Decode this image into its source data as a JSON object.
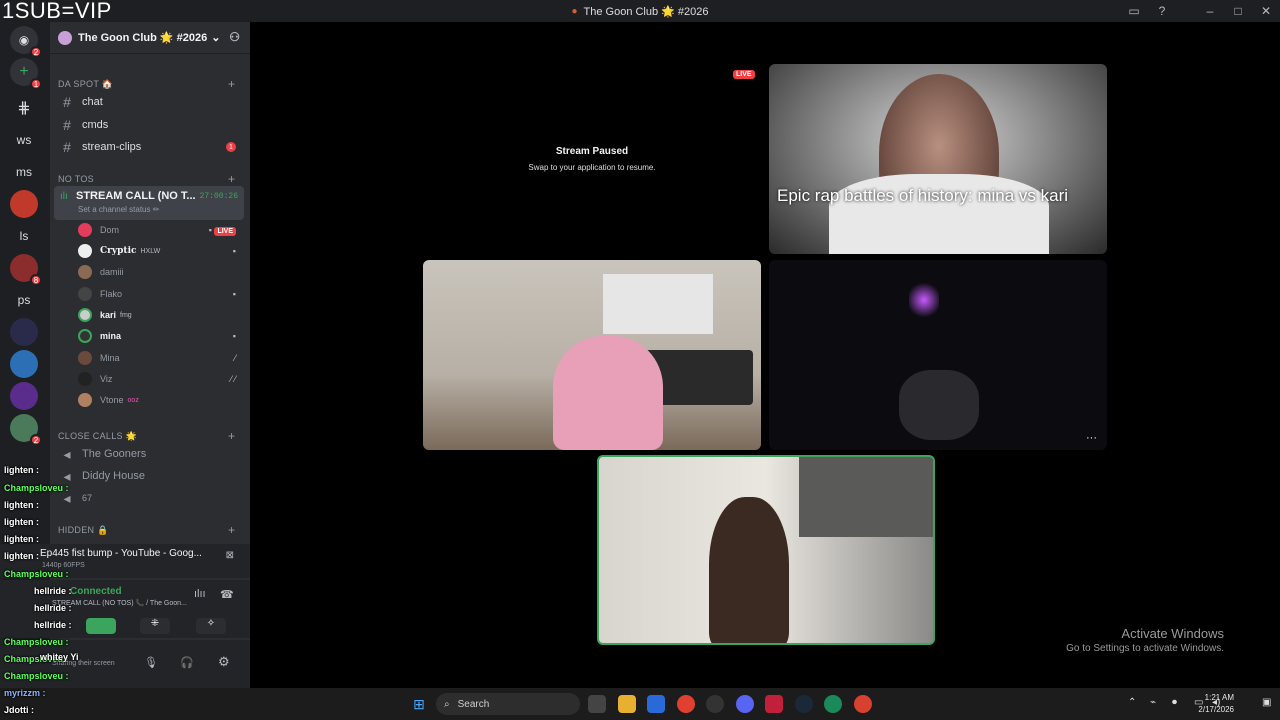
{
  "overlay_tag": "1SUB=VIP",
  "window": {
    "title": "The Goon Club 🌟 #2026"
  },
  "servers": [
    {
      "label": "",
      "badge": "2"
    },
    {
      "label": "",
      "badge": "1"
    },
    {
      "label": "",
      "badge": ""
    },
    {
      "label": "ws",
      "badge": ""
    },
    {
      "label": "ms",
      "badge": ""
    },
    {
      "label": "",
      "badge": ""
    },
    {
      "label": "ls",
      "badge": ""
    },
    {
      "label": "",
      "badge": "8"
    },
    {
      "label": "ps",
      "badge": ""
    },
    {
      "label": "",
      "badge": ""
    },
    {
      "label": "",
      "badge": ""
    },
    {
      "label": "",
      "badge": ""
    },
    {
      "label": "",
      "badge": "2"
    }
  ],
  "guild": {
    "name": "The Goon Club 🌟 #2026"
  },
  "categories": {
    "da_spot": "DA SPOT 🏠",
    "no_tos": "NO TOS",
    "close_calls": "CLOSE CALLS 🌟",
    "hidden": "HIDDEN 🔒"
  },
  "channels": [
    {
      "name": "chat",
      "unread": ""
    },
    {
      "name": "cmds",
      "unread": ""
    },
    {
      "name": "stream-clips",
      "unread": "1"
    }
  ],
  "voice_call": {
    "name": "STREAM CALL (NO T...",
    "status": "Set a channel status ✏",
    "timer": "27:00:26"
  },
  "voice_users": [
    {
      "name": "Dom",
      "tag": "",
      "live": "LIVE"
    },
    {
      "name": "Cryptic",
      "tag": "HXLW",
      "live": ""
    },
    {
      "name": "damiii",
      "tag": "",
      "live": ""
    },
    {
      "name": "Flako",
      "tag": "",
      "live": ""
    },
    {
      "name": "kari",
      "tag": "fmg",
      "live": ""
    },
    {
      "name": "mina",
      "tag": "",
      "live": ""
    },
    {
      "name": "Mina",
      "tag": "",
      "live": ""
    },
    {
      "name": "Viz",
      "tag": "",
      "live": ""
    },
    {
      "name": "Vtone",
      "tag": "ooz",
      "live": ""
    }
  ],
  "close_call_channels": [
    "The Gooners",
    "Diddy House",
    "67"
  ],
  "activity": {
    "title": "Ep445 fist bump - YouTube - Goog...",
    "quality": "1440p 60FPS",
    "connection": "Connected",
    "call_info": "STREAM CALL (NO TOS) 📞 / The Goon...",
    "sharing": "Sharing their screen"
  },
  "chat_overlay": [
    {
      "user": "lighten :",
      "color": "white"
    },
    {
      "user": "Champsloveu :",
      "color": "green"
    },
    {
      "user": "lighten :",
      "color": "white"
    },
    {
      "user": "lighten :",
      "color": "white"
    },
    {
      "user": "lighten :",
      "color": "white"
    },
    {
      "user": "lighten :",
      "color": "white"
    },
    {
      "user": "Champsloveu :",
      "color": "green"
    },
    {
      "user": "hellride :",
      "color": "white"
    },
    {
      "user": "hellride :",
      "color": "white"
    },
    {
      "user": "hellride :",
      "color": "white"
    },
    {
      "user": "Champsloveu :",
      "color": "green"
    },
    {
      "user": "Champsloveu :",
      "color": "green"
    },
    {
      "user": "whitey Yi",
      "color": "white"
    },
    {
      "user": "Champsloveu :",
      "color": "green"
    },
    {
      "user": "myrizzm :",
      "color": "white"
    },
    {
      "user": "Jdotti :",
      "color": "white"
    }
  ],
  "stage": {
    "paused_title": "Stream Paused",
    "paused_sub": "Swap to your application to resume.",
    "live_label": "LIVE",
    "caption": "Epic rap battles of history: mina vs kari",
    "more_label": "···"
  },
  "watermark": {
    "line1": "Activate Windows",
    "line2": "Go to Settings to activate Windows."
  },
  "taskbar": {
    "search_placeholder": "Search",
    "time": "1:21 AM",
    "date": "2/17/2026"
  }
}
